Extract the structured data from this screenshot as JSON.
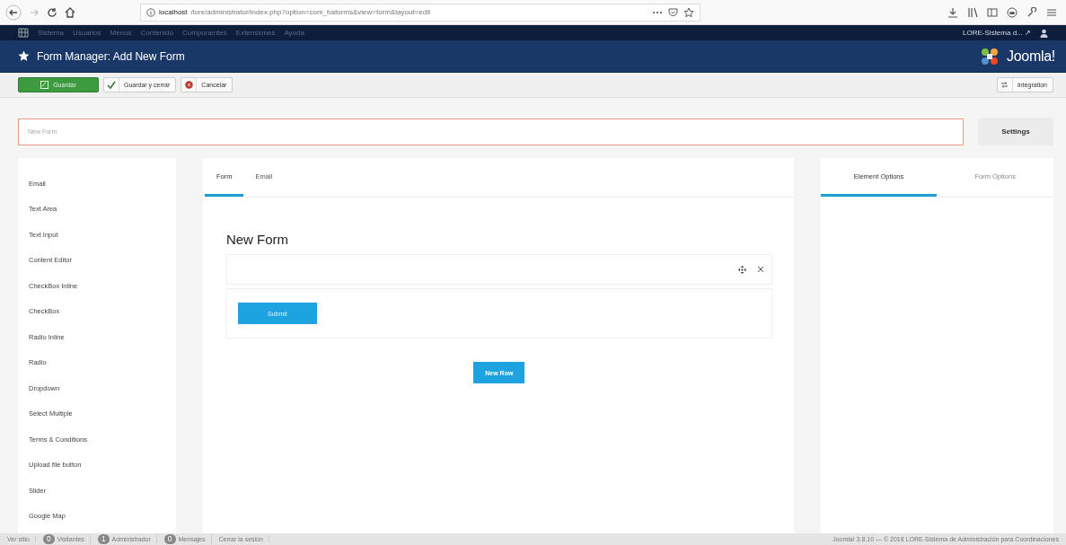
{
  "browser": {
    "url_host": "localhost",
    "url_path": "/lore/administrator/index.php?option=com_baforms&view=form&layout=edit"
  },
  "admin_menu": {
    "items": [
      "Sistema",
      "Usuarios",
      "Menús",
      "Contenido",
      "Componentes",
      "Extensiones",
      "Ayuda"
    ],
    "site": "LORE-Sistema d... ↗"
  },
  "title_bar": {
    "title": "Form Manager: Add New Form",
    "logo": "Joomla!"
  },
  "toolbar": {
    "buttons": [
      {
        "label": "Guardar",
        "kind": "primary"
      },
      {
        "label": "Guardar y cerrar",
        "kind": "check"
      },
      {
        "label": "Cancelar",
        "kind": "cancel"
      }
    ],
    "right_button": "Integration"
  },
  "form_name": {
    "placeholder": "New Form"
  },
  "settings_button": "Settings",
  "elements": [
    "Email",
    "Text Area",
    "Text Input",
    "Content Editor",
    "CheckBox Inline",
    "CheckBox",
    "Radio Inline",
    "Radio",
    "Dropdown",
    "Select Multiple",
    "Terms & Conditions",
    "Upload file button",
    "Slider",
    "Google Map"
  ],
  "center_tabs": [
    {
      "label": "Form",
      "selected": true
    },
    {
      "label": "Email",
      "selected": false
    }
  ],
  "form": {
    "title": "New Form",
    "submit": "Submit",
    "new_row": "New Row"
  },
  "right_tabs": [
    {
      "label": "Element Options",
      "selected": true
    },
    {
      "label": "Form Options",
      "selected": false
    }
  ],
  "status_bar": {
    "items": [
      {
        "label": "Ver sitio"
      },
      {
        "badge": "0",
        "label": "Visitantes"
      },
      {
        "badge": "1",
        "label": "Administrador"
      },
      {
        "badge": "0",
        "label": "Mensajes"
      },
      {
        "label": "Cerrar la sesión"
      }
    ],
    "version": "Joomla! 3.8.10 — © 2018 LORE-Sistema de Administración para Coordinaciones"
  }
}
